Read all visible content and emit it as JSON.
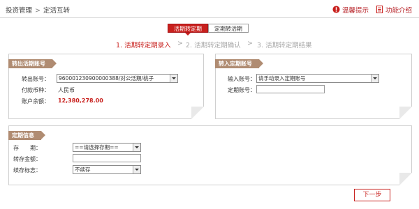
{
  "breadcrumb": {
    "parent": "投资管理",
    "separator": ">",
    "current": "定活互转"
  },
  "header_links": {
    "tips": "温馨提示",
    "intro": "功能介绍"
  },
  "tabs": [
    {
      "label": "活期转定期",
      "active": true
    },
    {
      "label": "定期转活期",
      "active": false
    }
  ],
  "steps": [
    {
      "label": "1. 活期转定期录入",
      "active": true
    },
    {
      "label": "2. 活期转定期确认",
      "active": false
    },
    {
      "label": "3. 活期转定期结果",
      "active": false
    }
  ],
  "step_separator": ">",
  "out_panel": {
    "title": "转出活期账号",
    "account_label": "转出账号：",
    "account_value": "960001230900000388/对公活期/桃子",
    "currency_label": "付款币种：",
    "currency_value": "人民币",
    "balance_label": "账户余额：",
    "balance_value": "12,380,278.00"
  },
  "in_panel": {
    "title": "转入定期账号",
    "input_label": "输入账号：",
    "input_value": "请手动录入定期账号",
    "fixed_label": "定期账号：",
    "fixed_value": ""
  },
  "fixed_panel": {
    "title": "定期信息",
    "term_label": "存　　期：",
    "term_value": "==请选择存期==",
    "amount_label": "转存金额：",
    "amount_value": "",
    "renew_label": "续存标志：",
    "renew_value": "不续存"
  },
  "actions": {
    "next": "下一步"
  },
  "colors": {
    "accent": "#c8201d",
    "panel_title_bg": "#b08c72",
    "muted": "#a8a8a8"
  }
}
